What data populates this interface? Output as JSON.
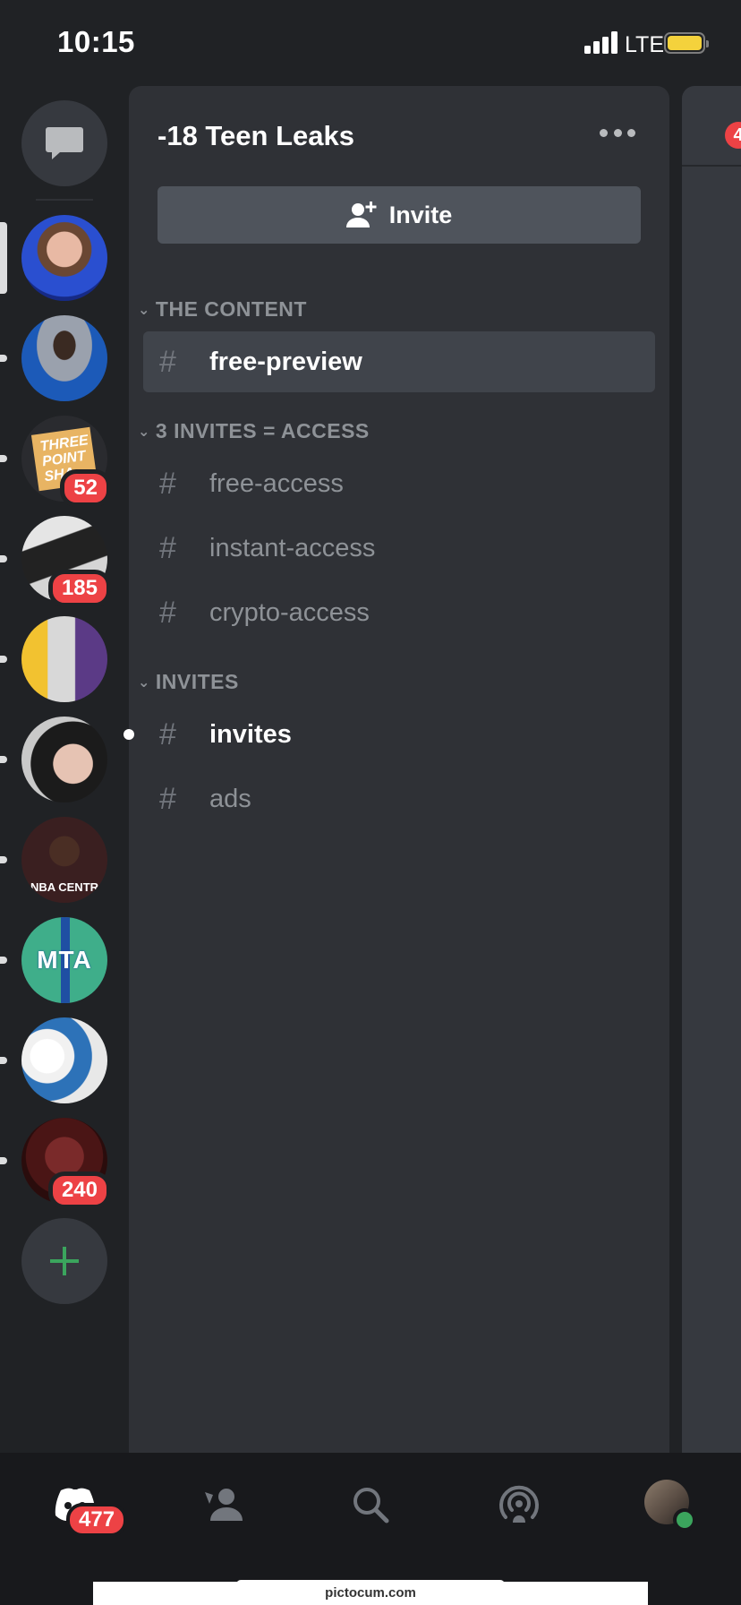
{
  "status_bar": {
    "time": "10:15",
    "network": "LTE"
  },
  "server": {
    "name": "-18 Teen Leaks",
    "invite_label": "Invite"
  },
  "categories": [
    {
      "label": "THE CONTENT"
    },
    {
      "label": "3 INVITES = ACCESS"
    },
    {
      "label": "INVITES"
    }
  ],
  "channels": [
    {
      "name": "free-preview"
    },
    {
      "name": "free-access"
    },
    {
      "name": "instant-access"
    },
    {
      "name": "crypto-access"
    },
    {
      "name": "invites"
    },
    {
      "name": "ads"
    }
  ],
  "rail": {
    "badges": [
      "52",
      "185",
      "240"
    ],
    "server_logo_text": [
      "THREE",
      "POINT",
      "SHA"
    ],
    "server_logo_text_2": "MTA",
    "server_logo_text_3": "NBA CENTR"
  },
  "bottom_nav": {
    "home_badge": "477"
  },
  "peek": {
    "badge": "4"
  },
  "watermark": "pictocum.com",
  "colors": {
    "background": "#202225",
    "panel": "#2f3136",
    "active_channel": "#40444b",
    "badge_red": "#ed4245",
    "online_green": "#3ba55d",
    "add_green": "#3ba55d"
  },
  "icons": [
    "dm-chat-icon",
    "add-server-icon",
    "add-user-icon",
    "more-options-icon",
    "home-icon",
    "friends-icon",
    "search-icon",
    "mentions-icon"
  ]
}
